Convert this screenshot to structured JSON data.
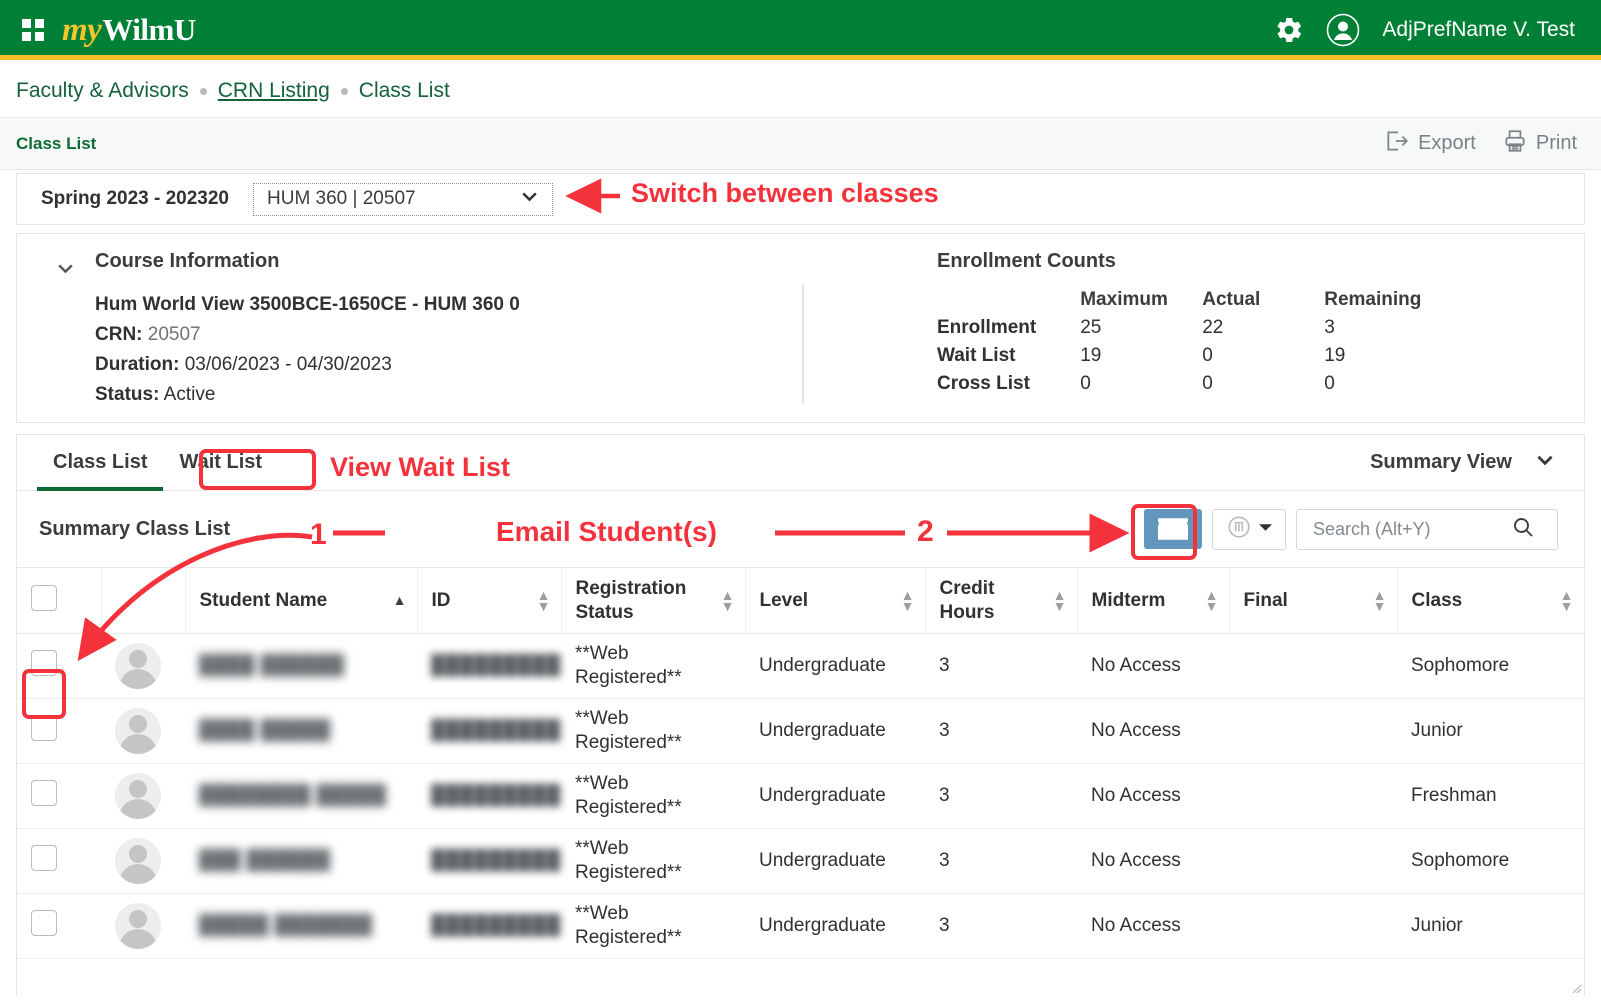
{
  "topbar": {
    "apps_icon": "grid-apps-icon",
    "brand_my": "my",
    "brand_rest": "WilmU",
    "gear_icon": "gear-icon",
    "avatar_icon": "user-avatar-icon",
    "username": "AdjPrefName V. Test"
  },
  "breadcrumb": {
    "items": [
      {
        "label": "Faculty & Advisors",
        "link": false
      },
      {
        "label": "CRN Listing",
        "link": true
      },
      {
        "label": "Class List",
        "link": false
      }
    ]
  },
  "page_head": {
    "title": "Class List",
    "export_label": "Export",
    "export_icon": "export-icon",
    "print_label": "Print",
    "print_icon": "printer-icon"
  },
  "selector": {
    "term": "Spring 2023 - 202320",
    "course_value": "HUM 360 | 20507",
    "chevron_icon": "chevron-down-icon"
  },
  "course_information": {
    "collapse_icon": "chevron-down-icon",
    "heading": "Course Information",
    "course_title": "Hum World View 3500BCE-1650CE - HUM 360 0",
    "crn_label": "CRN:",
    "crn_value": "20507",
    "duration_label": "Duration:",
    "duration_value": "03/06/2023 - 04/30/2023",
    "status_label": "Status:",
    "status_value": "Active"
  },
  "enrollment_counts": {
    "heading": "Enrollment Counts",
    "columns": [
      "Maximum",
      "Actual",
      "Remaining"
    ],
    "rows": [
      {
        "label": "Enrollment",
        "values": [
          "25",
          "22",
          "3"
        ]
      },
      {
        "label": "Wait List",
        "values": [
          "19",
          "0",
          "19"
        ]
      },
      {
        "label": "Cross List",
        "values": [
          "0",
          "0",
          "0"
        ]
      }
    ]
  },
  "tabs": [
    {
      "label": "Class List",
      "active": true
    },
    {
      "label": "Wait List",
      "active": false
    }
  ],
  "view_switch": {
    "label": "Summary View",
    "chevron_icon": "chevron-down-icon"
  },
  "listbar": {
    "title": "Summary Class List",
    "mail_icon": "envelope-icon",
    "columns_icon": "columns-chooser-icon",
    "columns_chevron_icon": "caret-down-icon",
    "search_placeholder": "Search (Alt+Y)",
    "search_value": "",
    "search_icon": "search-icon"
  },
  "table": {
    "select_all_checkbox": "unchecked",
    "columns": [
      {
        "label": "Student Name",
        "sort": "asc"
      },
      {
        "label": "ID",
        "sort": "none"
      },
      {
        "label": "Registration Status",
        "sort": "none"
      },
      {
        "label": "Level",
        "sort": "none"
      },
      {
        "label": "Credit Hours",
        "sort": "none"
      },
      {
        "label": "Midterm",
        "sort": "none"
      },
      {
        "label": "Final",
        "sort": "none"
      },
      {
        "label": "Class",
        "sort": "none"
      }
    ],
    "rows": [
      {
        "name": "████ ██████",
        "id": "█████████",
        "registration_status": "**Web Registered**",
        "level": "Undergraduate",
        "credit_hours": "3",
        "midterm": "No Access",
        "final": "",
        "class": "Sophomore"
      },
      {
        "name": "████ █████",
        "id": "█████████",
        "registration_status": "**Web Registered**",
        "level": "Undergraduate",
        "credit_hours": "3",
        "midterm": "No Access",
        "final": "",
        "class": "Junior"
      },
      {
        "name": "████████ █████",
        "id": "█████████",
        "registration_status": "**Web Registered**",
        "level": "Undergraduate",
        "credit_hours": "3",
        "midterm": "No Access",
        "final": "",
        "class": "Freshman"
      },
      {
        "name": "███ ██████",
        "id": "█████████",
        "registration_status": "**Web Registered**",
        "level": "Undergraduate",
        "credit_hours": "3",
        "midterm": "No Access",
        "final": "",
        "class": "Sophomore"
      },
      {
        "name": "█████ ███████",
        "id": "█████████",
        "registration_status": "**Web Registered**",
        "level": "Undergraduate",
        "credit_hours": "3",
        "midterm": "No Access",
        "final": "",
        "class": "Junior"
      }
    ]
  },
  "annotations": {
    "accent_color": "#f4323c",
    "switch_classes": "Switch between classes",
    "view_wait_list": "View Wait List",
    "email_students": "Email Student(s)",
    "step_1": "1",
    "step_2": "2"
  }
}
